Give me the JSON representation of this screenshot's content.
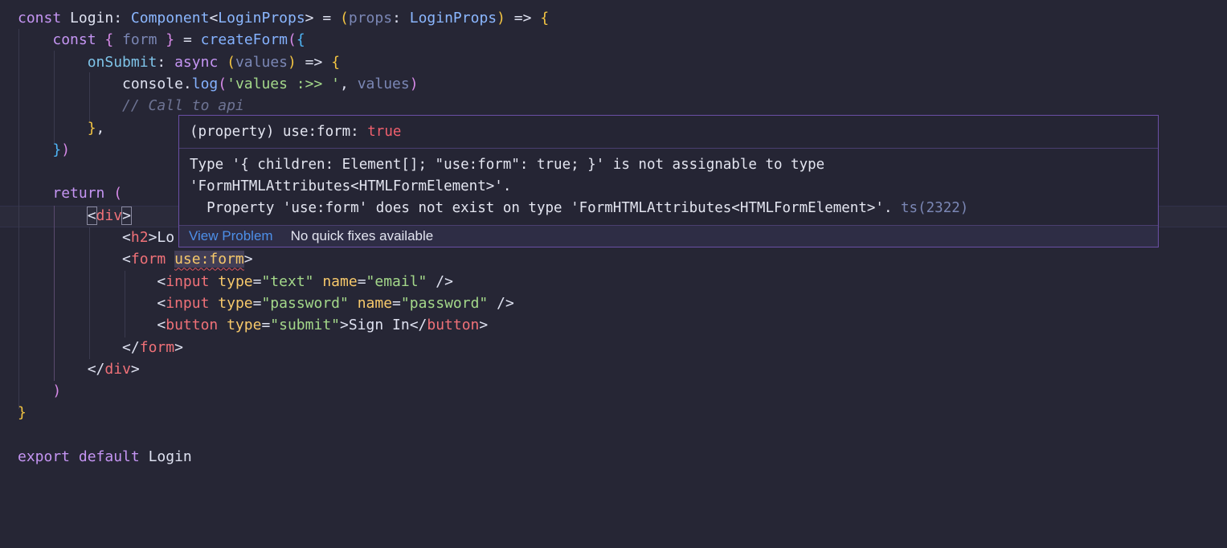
{
  "editor": {
    "lines": [
      [
        [
          "kw",
          "const "
        ],
        [
          "id",
          "Login"
        ],
        [
          "op",
          ": "
        ],
        [
          "type",
          "Component"
        ],
        [
          "op",
          "<"
        ],
        [
          "type",
          "LoginProps"
        ],
        [
          "op",
          "> = "
        ],
        [
          "p1",
          "("
        ],
        [
          "param",
          "props"
        ],
        [
          "op",
          ": "
        ],
        [
          "type",
          "LoginProps"
        ],
        [
          "p1",
          ")"
        ],
        [
          "op",
          " => "
        ],
        [
          "p1",
          "{"
        ]
      ],
      [
        [
          "op",
          "    "
        ],
        [
          "kw",
          "const "
        ],
        [
          "p2",
          "{ "
        ],
        [
          "param",
          "form"
        ],
        [
          "p2",
          " }"
        ],
        [
          "op",
          " = "
        ],
        [
          "fn",
          "createForm"
        ],
        [
          "p2",
          "("
        ],
        [
          "p3",
          "{"
        ]
      ],
      [
        [
          "op",
          "        "
        ],
        [
          "prop",
          "onSubmit"
        ],
        [
          "op",
          ": "
        ],
        [
          "kw",
          "async "
        ],
        [
          "p1",
          "("
        ],
        [
          "param",
          "values"
        ],
        [
          "p1",
          ")"
        ],
        [
          "op",
          " => "
        ],
        [
          "p1",
          "{"
        ]
      ],
      [
        [
          "op",
          "            "
        ],
        [
          "id",
          "console"
        ],
        [
          "op",
          "."
        ],
        [
          "fn",
          "log"
        ],
        [
          "p2",
          "("
        ],
        [
          "str",
          "'values :>> '"
        ],
        [
          "op",
          ", "
        ],
        [
          "param",
          "values"
        ],
        [
          "p2",
          ")"
        ]
      ],
      [
        [
          "op",
          "            "
        ],
        [
          "cmt",
          "// Call to api"
        ]
      ],
      [
        [
          "op",
          "        "
        ],
        [
          "p1",
          "}"
        ],
        [
          "op",
          ","
        ]
      ],
      [
        [
          "op",
          "    "
        ],
        [
          "p3",
          "}"
        ],
        [
          "p2",
          ")"
        ]
      ],
      [],
      [
        [
          "op",
          "    "
        ],
        [
          "kw",
          "return "
        ],
        [
          "p2",
          "("
        ]
      ],
      [
        [
          "op",
          "        "
        ],
        [
          "op",
          "<"
        ],
        [
          "tag",
          "div"
        ],
        [
          "op",
          ">"
        ]
      ],
      [
        [
          "op",
          "            "
        ],
        [
          "op",
          "<"
        ],
        [
          "tag",
          "h2"
        ],
        [
          "op",
          ">Lo"
        ]
      ],
      [
        [
          "op",
          "            "
        ],
        [
          "op",
          "<"
        ],
        [
          "tag",
          "form "
        ],
        [
          "attr",
          "use:form"
        ],
        [
          "op",
          ">"
        ]
      ],
      [
        [
          "op",
          "                "
        ],
        [
          "op",
          "<"
        ],
        [
          "tag",
          "input "
        ],
        [
          "attr",
          "type"
        ],
        [
          "op",
          "="
        ],
        [
          "str",
          "\"text\" "
        ],
        [
          "attr",
          "name"
        ],
        [
          "op",
          "="
        ],
        [
          "str",
          "\"email\" "
        ],
        [
          "op",
          "/>"
        ]
      ],
      [
        [
          "op",
          "                "
        ],
        [
          "op",
          "<"
        ],
        [
          "tag",
          "input "
        ],
        [
          "attr",
          "type"
        ],
        [
          "op",
          "="
        ],
        [
          "str",
          "\"password\" "
        ],
        [
          "attr",
          "name"
        ],
        [
          "op",
          "="
        ],
        [
          "str",
          "\"password\" "
        ],
        [
          "op",
          "/>"
        ]
      ],
      [
        [
          "op",
          "                "
        ],
        [
          "op",
          "<"
        ],
        [
          "tag",
          "button "
        ],
        [
          "attr",
          "type"
        ],
        [
          "op",
          "="
        ],
        [
          "str",
          "\"submit\""
        ],
        [
          "op",
          ">Sign In</"
        ],
        [
          "tag",
          "button"
        ],
        [
          "op",
          ">"
        ]
      ],
      [
        [
          "op",
          "            "
        ],
        [
          "op",
          "</"
        ],
        [
          "tag",
          "form"
        ],
        [
          "op",
          ">"
        ]
      ],
      [
        [
          "op",
          "        "
        ],
        [
          "op",
          "</"
        ],
        [
          "tag",
          "div"
        ],
        [
          "op",
          ">"
        ]
      ],
      [
        [
          "op",
          "    "
        ],
        [
          "p2",
          ")"
        ]
      ],
      [
        [
          "p1",
          "}"
        ]
      ],
      [],
      [
        [
          "kw",
          "export "
        ],
        [
          "kw",
          "default "
        ],
        [
          "id",
          "Login"
        ]
      ]
    ]
  },
  "hover": {
    "signature_prefix": "(property) use:form: ",
    "signature_value": "true",
    "message_line1": "Type '{ children: Element[]; \"use:form\": true; }' is not assignable to type",
    "message_line2": "'FormHTMLAttributes<HTMLFormElement>'.",
    "message_line3": "  Property 'use:form' does not exist on type 'FormHTMLAttributes<HTMLFormElement>'. ",
    "error_code": "ts(2322)",
    "view_problem_label": "View Problem",
    "no_fixes_label": "No quick fixes available"
  }
}
